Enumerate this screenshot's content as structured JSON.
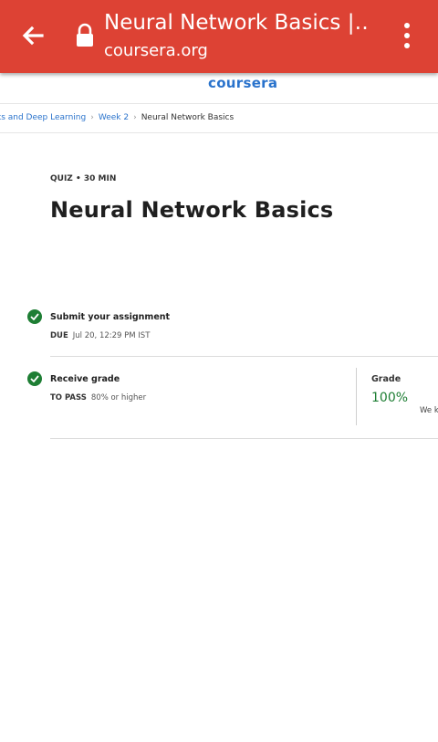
{
  "browser": {
    "tab_title": "Neural Network Basics |…",
    "url": "coursera.org",
    "accent_color": "#dd4234",
    "icons": [
      "back-arrow-icon",
      "lock-icon",
      "more-vert-icon"
    ]
  },
  "site": {
    "logo_text": "coursera",
    "logo_color": "#2a73cc"
  },
  "breadcrumb": {
    "items": [
      "ks and Deep Learning",
      "Week 2",
      "Neural Network Basics"
    ]
  },
  "quiz": {
    "meta": "QUIZ • 30 MIN",
    "title": "Neural Network Basics"
  },
  "steps": [
    {
      "title": "Submit your assignment",
      "sub_key": "DUE",
      "sub_value": "Jul 20, 12:29 PM IST",
      "done": true
    },
    {
      "title": "Receive grade",
      "sub_key": "TO PASS",
      "sub_value": "80% or higher",
      "done": true
    }
  ],
  "grade": {
    "label": "Grade",
    "value": "100%",
    "note": "We k"
  },
  "status_color": "#1e7e34"
}
